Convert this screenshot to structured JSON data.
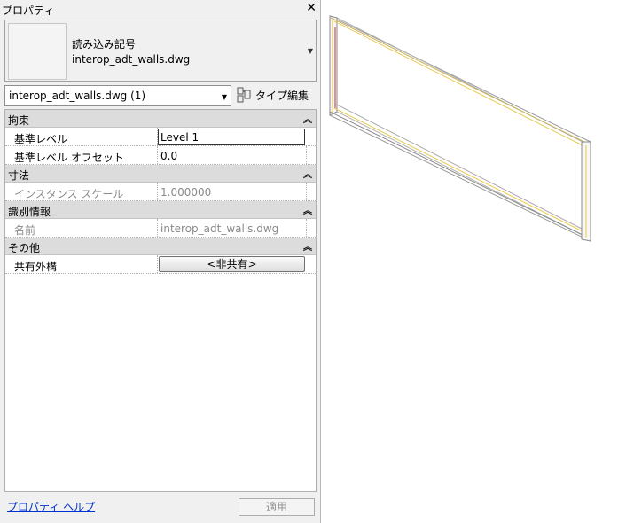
{
  "panel": {
    "title": "プロパティ",
    "close_glyph": "✕",
    "type_selector": {
      "line1": "読み込み記号",
      "line2": "interop_adt_walls.dwg"
    },
    "instance_filter": "interop_adt_walls.dwg (1)",
    "type_edit_label": "タイプ編集",
    "sections": {
      "constraints": {
        "label": "拘束",
        "rows": [
          {
            "key": "基準レベル",
            "value": "Level 1"
          },
          {
            "key": "基準レベル オフセット",
            "value": "0.0"
          }
        ]
      },
      "dimensions": {
        "label": "寸法",
        "rows": [
          {
            "key": "インスタンス スケール",
            "value": "1.000000"
          }
        ]
      },
      "identity": {
        "label": "識別情報",
        "rows": [
          {
            "key": "名前",
            "value": "interop_adt_walls.dwg"
          }
        ]
      },
      "other": {
        "label": "その他",
        "rows": [
          {
            "key": "共有外構",
            "value": "<非共有>"
          }
        ]
      }
    },
    "help_link": "プロパティ ヘルプ",
    "apply_button": "適用"
  },
  "colors": {
    "panel_bg": "#f0f0f0",
    "section_bg": "#dcdcdc",
    "link": "#0033cc",
    "wall_outline": "#888888",
    "wall_accent_yellow": "#e8c84a",
    "wall_accent_red": "#c03030"
  },
  "icons": {
    "close": "close-icon",
    "collapse": "chevron-up-double-icon",
    "dropdown": "chevron-down-icon",
    "type_edit": "type-edit-icon"
  }
}
